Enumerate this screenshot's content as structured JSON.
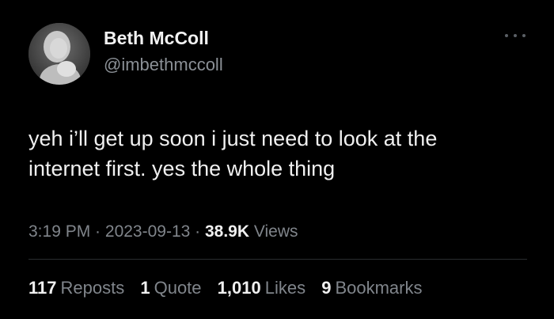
{
  "author": {
    "name": "Beth McColl",
    "handle": "@imbethmccoll"
  },
  "tweet": {
    "lines": [
      "yeh i’ll get up soon i just need to look at the",
      "internet first. yes the whole thing"
    ]
  },
  "meta": {
    "time": "3:19 PM",
    "separator1": " · ",
    "date": "2023-09-13",
    "separator2": " · ",
    "views_count": "38.9K",
    "views_label": "Views"
  },
  "stats": {
    "reposts_count": "117",
    "reposts_label": "Reposts",
    "quotes_count": "1",
    "quotes_label": "Quote",
    "likes_count": "1,010",
    "likes_label": "Likes",
    "bookmarks_count": "9",
    "bookmarks_label": "Bookmarks"
  },
  "icons": {
    "more": "more-horizontal-icon"
  },
  "colors": {
    "background": "#000000",
    "text_primary": "#f0f0f0",
    "text_secondary": "#80858b",
    "divider": "#2a2d30"
  }
}
